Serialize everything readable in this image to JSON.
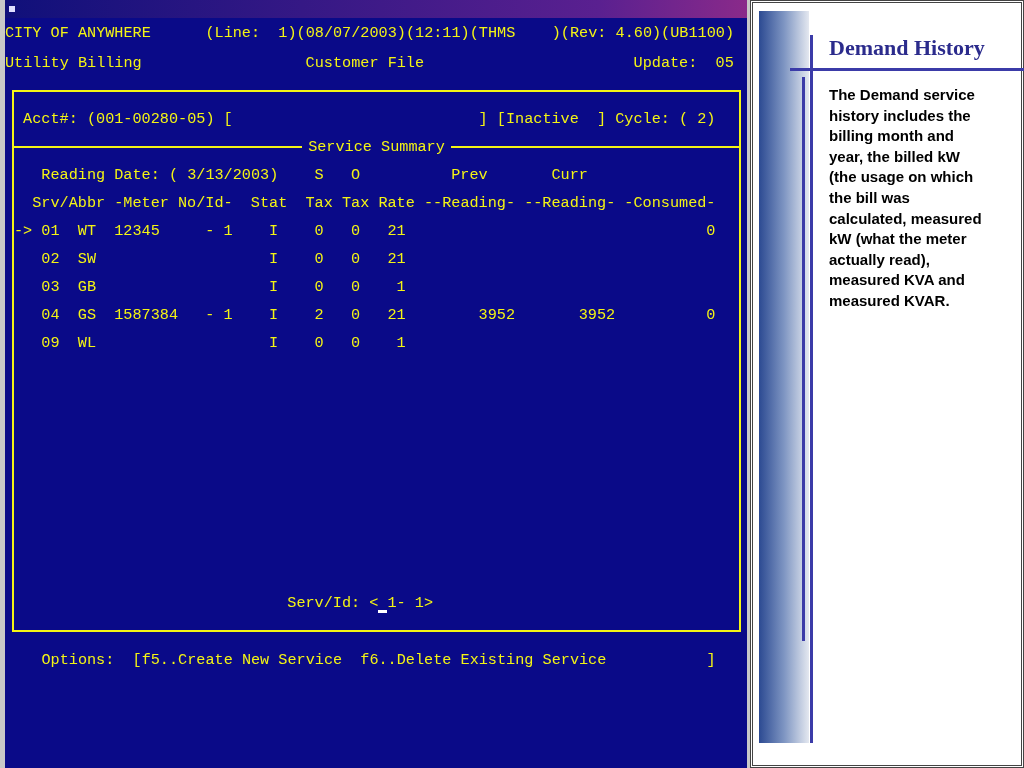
{
  "terminal": {
    "header": {
      "org": "CITY OF ANYWHERE",
      "line_info": "(Line:  1)(08/07/2003)(12:11)(THMS    )(Rev: 4.60)(UB1100)",
      "app": "Utility Billing",
      "screen": "Customer File",
      "update": "Update:  05"
    },
    "account": {
      "acct": "Acct#: (001-00280-05) [",
      "status": "] [Inactive  ]",
      "cycle": "Cycle: ( 2)"
    },
    "section_title": "Service Summary",
    "reading_date": "Reading Date: ( 3/13/2003)",
    "group_headers": [
      "S",
      "O",
      "Prev",
      "Curr"
    ],
    "columns": [
      "Srv/Abbr",
      "-Meter No/Id-",
      "Stat",
      "Tax",
      "Tax",
      "Rate",
      "--Reading-",
      "--Reading-",
      "-Consumed-"
    ],
    "row_pointer": "->",
    "rows": [
      {
        "selected": true,
        "srv": "01",
        "abbr": "WT",
        "meter": "12345",
        "id": "- 1",
        "stat": "I",
        "s_tax": "0",
        "o_tax": "0",
        "rate": "21",
        "prev": "",
        "curr": "",
        "consumed": "0"
      },
      {
        "selected": false,
        "srv": "02",
        "abbr": "SW",
        "meter": "",
        "id": "",
        "stat": "I",
        "s_tax": "0",
        "o_tax": "0",
        "rate": "21",
        "prev": "",
        "curr": "",
        "consumed": ""
      },
      {
        "selected": false,
        "srv": "03",
        "abbr": "GB",
        "meter": "",
        "id": "",
        "stat": "I",
        "s_tax": "0",
        "o_tax": "0",
        "rate": "1",
        "prev": "",
        "curr": "",
        "consumed": ""
      },
      {
        "selected": false,
        "srv": "04",
        "abbr": "GS",
        "meter": "1587384",
        "id": "- 1",
        "stat": "I",
        "s_tax": "2",
        "o_tax": "0",
        "rate": "21",
        "prev": "3952",
        "curr": "3952",
        "consumed": "0"
      },
      {
        "selected": false,
        "srv": "09",
        "abbr": "WL",
        "meter": "",
        "id": "",
        "stat": "I",
        "s_tax": "0",
        "o_tax": "0",
        "rate": "1",
        "prev": "",
        "curr": "",
        "consumed": ""
      }
    ],
    "prompt": {
      "label": "Serv/Id:",
      "value": "< 1- 1>"
    },
    "options": {
      "label": "Options:",
      "open": "[",
      "items": [
        "f5..Create New Service",
        "f6..Delete Existing Service"
      ],
      "close": "]"
    }
  },
  "slide": {
    "title": "Demand History",
    "body": "The Demand service history includes the billing month and year, the billed kW (the usage on which the bill was calculated, measured kW (what the meter actually read), measured KVA and measured KVAR."
  }
}
